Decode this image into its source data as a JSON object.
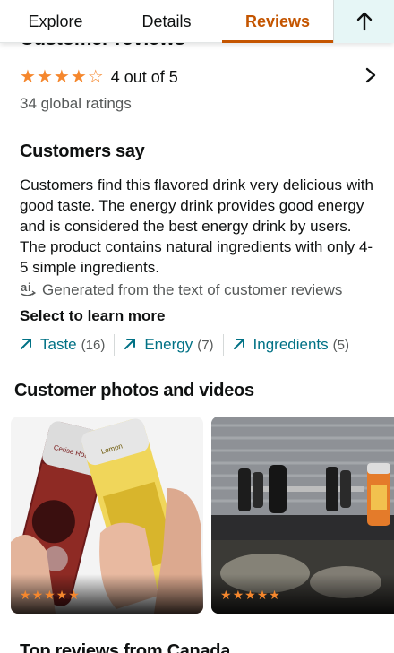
{
  "tabs": [
    {
      "label": "Explore"
    },
    {
      "label": "Details"
    },
    {
      "label": "Reviews",
      "active": true
    }
  ],
  "scroll_top_icon": "arrow-up-icon",
  "header": {
    "peek_title": "Customer reviews"
  },
  "rating": {
    "stars": 4,
    "max_stars": 5,
    "text": "4 out of 5",
    "global_ratings": "34 global ratings"
  },
  "customers_say": {
    "title": "Customers say",
    "body": "Customers find this flavored drink very delicious with good taste. The energy drink provides good energy and is considered the best energy drink by users. The product contains natural ingredients with only 4-5 simple ingredients.",
    "ai_note": "Generated from the text of customer reviews",
    "select_title": "Select to learn more",
    "chips": [
      {
        "label": "Taste",
        "count": "(16)"
      },
      {
        "label": "Energy",
        "count": "(7)"
      },
      {
        "label": "Ingredients",
        "count": "(5)"
      }
    ]
  },
  "photos": {
    "title": "Customer photos and videos",
    "items": [
      {
        "can_left": "Cerise Rouge",
        "can_right": "Lemon",
        "stars": 5
      },
      {
        "stars": 5
      }
    ]
  },
  "next_section": {
    "title": "Top reviews from Canada"
  },
  "colors": {
    "accent": "#c45500",
    "star": "#f5872d",
    "link": "#007185",
    "muted": "#565959"
  }
}
